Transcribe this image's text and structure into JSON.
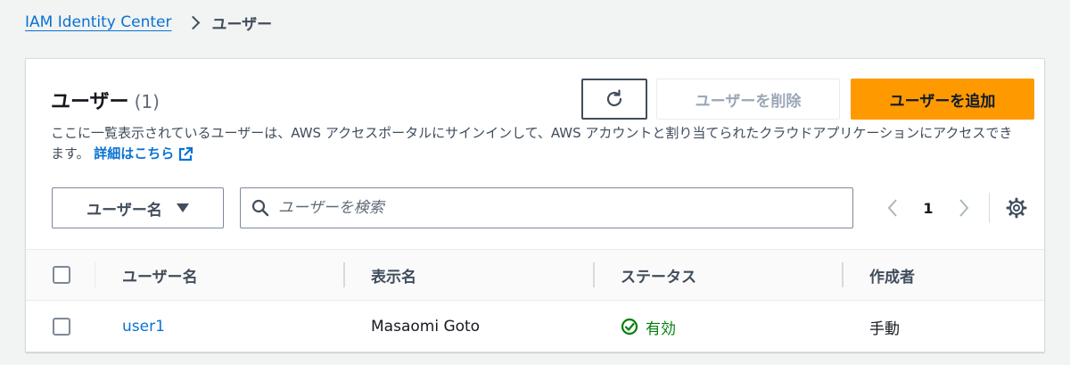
{
  "breadcrumb": {
    "parent": "IAM Identity Center",
    "current": "ユーザー"
  },
  "panel": {
    "title": "ユーザー",
    "count": "(1)",
    "delete_label": "ユーザーを削除",
    "add_label": "ユーザーを追加",
    "description": "ここに一覧表示されているユーザーは、AWS アクセスポータルにサインインして、AWS アカウントと割り当てられたクラウドアプリケーションにアクセスできます。",
    "learn_more": "詳細はこちら"
  },
  "filter": {
    "property": "ユーザー名",
    "search_placeholder": "ユーザーを検索"
  },
  "pagination": {
    "current_page": "1"
  },
  "table": {
    "columns": [
      "ユーザー名",
      "表示名",
      "ステータス",
      "作成者"
    ],
    "rows": [
      {
        "username": "user1",
        "display_name": "Masaomi Goto",
        "status": "有効",
        "created_by": "手動"
      }
    ]
  },
  "icons": {
    "refresh": "refresh-icon",
    "external_link": "external-link-icon",
    "search": "search-icon",
    "settings": "gear-icon",
    "status_ok": "check-circle-icon"
  },
  "colors": {
    "link": "#0972d3",
    "primary_button": "#ff9900",
    "success": "#037f0c"
  }
}
